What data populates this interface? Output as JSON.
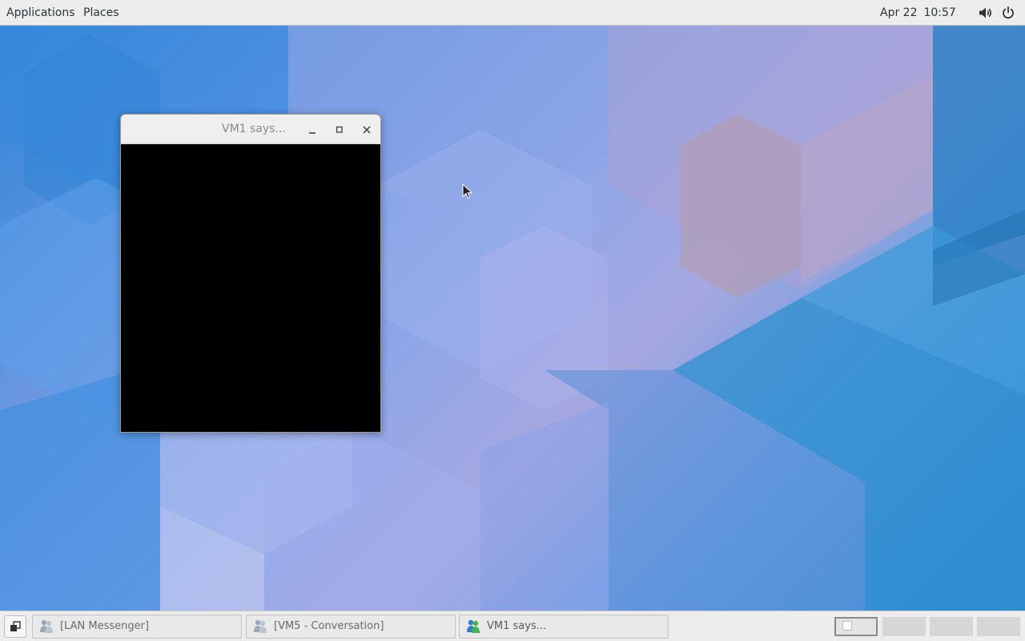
{
  "top_panel": {
    "applications_label": "Applications",
    "places_label": "Places",
    "clock_date": "Apr 22",
    "clock_time": "10:57",
    "volume_icon": "volume-icon",
    "power_icon": "power-icon"
  },
  "dialog": {
    "title": "VM1 says...",
    "minimize_icon": "minimize-icon",
    "maximize_icon": "maximize-icon",
    "close_icon": "close-icon"
  },
  "taskbar": {
    "show_desktop_icon": "show-desktop-icon",
    "tasks": [
      {
        "label": "[LAN Messenger]",
        "icon": "lan-messenger-icon"
      },
      {
        "label": "[VM5 - Conversation]",
        "icon": "lan-messenger-icon"
      },
      {
        "label": "VM1 says...",
        "icon": "lan-messenger-icon"
      }
    ],
    "workspaces": [
      {
        "name": "workspace-1",
        "active": true
      },
      {
        "name": "workspace-2",
        "active": false
      },
      {
        "name": "workspace-3",
        "active": false
      },
      {
        "name": "workspace-4",
        "active": false
      }
    ]
  },
  "colors": {
    "panel": "#ededed",
    "wallpaper_blue": "#2d85d6",
    "wallpaper_lavender": "#a6a7df",
    "dialog_content": "#000000"
  }
}
